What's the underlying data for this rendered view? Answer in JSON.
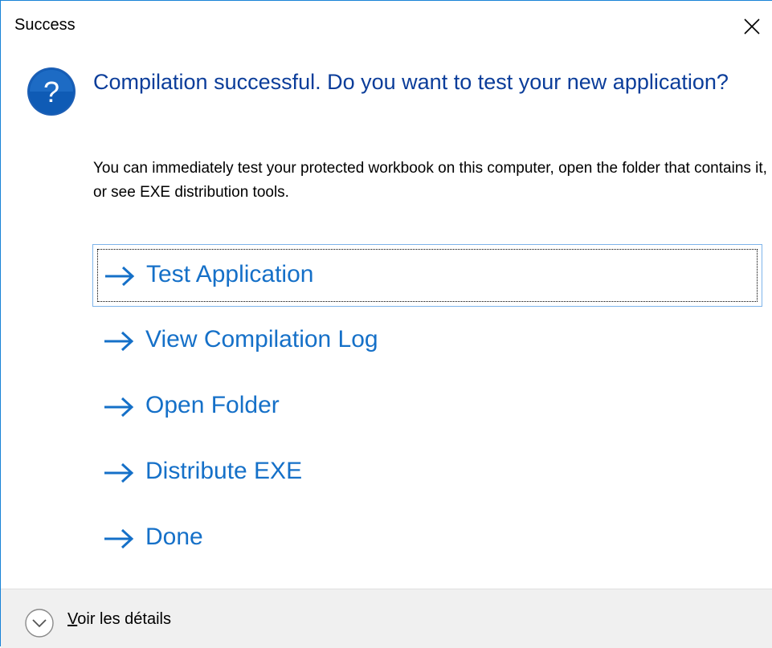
{
  "window": {
    "title": "Success"
  },
  "main_instruction": "Compilation successful. Do you want to test your new application?",
  "content": "You can immediately test your protected workbook on this computer, open the folder that contains it, or see EXE distribution tools.",
  "command_links": [
    {
      "label": "Test Application"
    },
    {
      "label": "View Compilation Log"
    },
    {
      "label": "Open Folder"
    },
    {
      "label": "Distribute EXE"
    },
    {
      "label": "Done"
    }
  ],
  "footer": {
    "details_mnemonic": "V",
    "details_rest": "oir les détails"
  },
  "colors": {
    "accent_blue": "#1570c8",
    "instruction_blue": "#0b3d9a",
    "footer_bg": "#f0f0f0"
  },
  "icons": {
    "main": "question-icon",
    "close": "close-icon",
    "command": "arrow-right-icon",
    "expand": "chevron-down-icon"
  }
}
